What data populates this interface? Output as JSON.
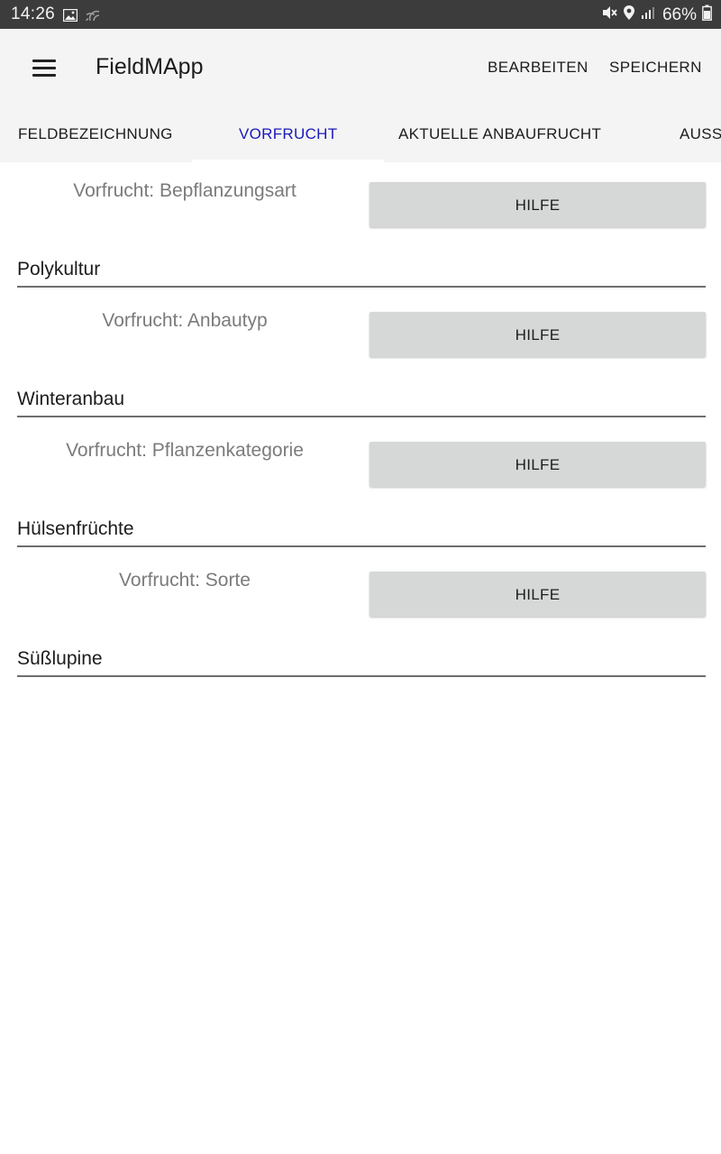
{
  "status_bar": {
    "time": "14:26",
    "battery": "66%",
    "icons": [
      "gallery-icon",
      "cast-icon",
      "mute-icon",
      "location-icon",
      "signal-icon",
      "battery-icon"
    ]
  },
  "app_bar": {
    "title": "FieldMApp",
    "actions": {
      "edit": "BEARBEITEN",
      "save": "SPEICHERN"
    }
  },
  "tabs": [
    {
      "label": "FELDBEZEICHNUNG",
      "active": false
    },
    {
      "label": "VORFRUCHT",
      "active": true
    },
    {
      "label": "AKTUELLE ANBAUFRUCHT",
      "active": false
    },
    {
      "label": "AUSS",
      "active": false
    }
  ],
  "fields": [
    {
      "label": "Vorfrucht: Bepflanzungsart",
      "help": "HILFE",
      "value": "Polykultur"
    },
    {
      "label": "Vorfrucht: Anbautyp",
      "help": "HILFE",
      "value": "Winteranbau"
    },
    {
      "label": "Vorfrucht: Pflanzenkategorie",
      "help": "HILFE",
      "value": "Hülsenfrüchte"
    },
    {
      "label": "Vorfrucht: Sorte",
      "help": "HILFE",
      "value": "Süßlupine"
    }
  ],
  "colors": {
    "status_bar_bg": "#3c3c3c",
    "app_bar_bg": "#f4f4f4",
    "active_tab": "#1a1ab8",
    "button_bg": "#d6d7d7"
  }
}
